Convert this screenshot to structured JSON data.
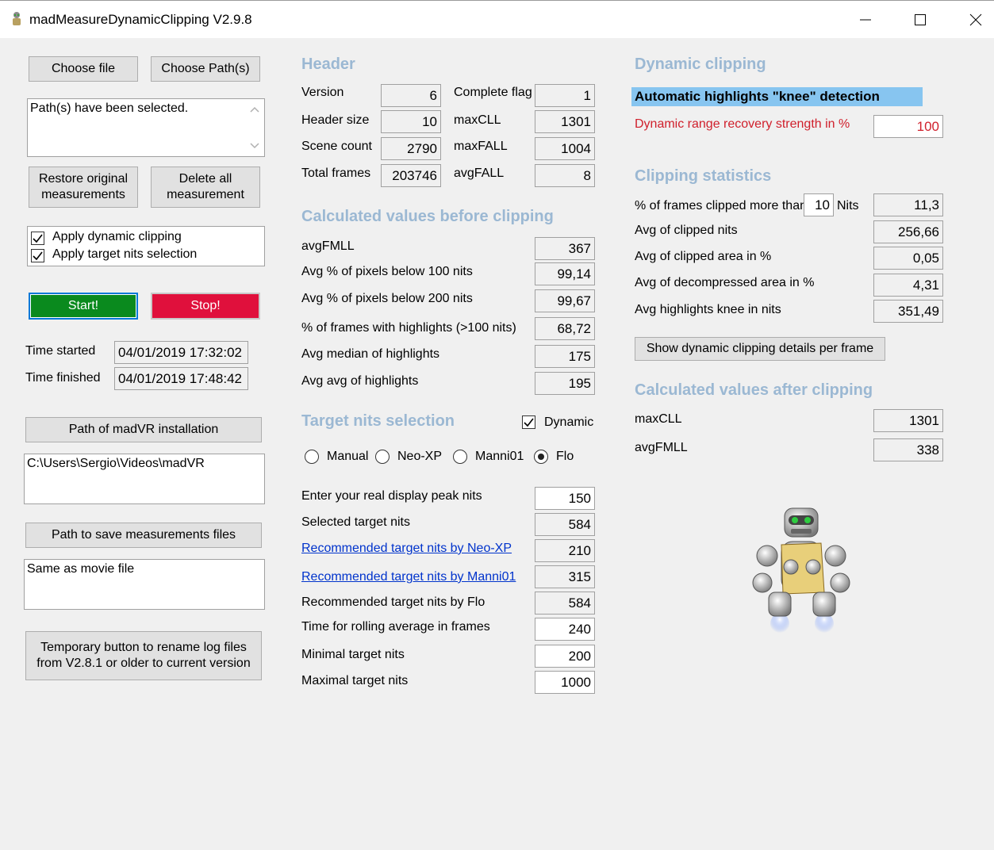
{
  "window": {
    "title": "madMeasureDynamicClipping V2.9.8"
  },
  "left": {
    "choose_file": "Choose file",
    "choose_paths": "Choose Path(s)",
    "status_text": "Path(s) have been selected.",
    "restore_line1": "Restore original",
    "restore_line2": "measurements",
    "delete_line1": "Delete all",
    "delete_line2": "measurement",
    "apply_dynamic_clipping": "Apply dynamic clipping",
    "apply_target_nits": "Apply target nits selection",
    "start": "Start!",
    "stop": "Stop!",
    "time_started_label": "Time started",
    "time_started": "04/01/2019 17:32:02",
    "time_finished_label": "Time finished",
    "time_finished": "04/01/2019 17:48:42",
    "madvr_path_button": "Path of madVR installation",
    "madvr_path": "C:\\Users\\Sergio\\Videos\\madVR",
    "save_path_button": "Path to save measurements files",
    "save_path": "Same as movie file",
    "rename_line1": "Temporary button to rename log files",
    "rename_line2": "from V2.8.1 or older to current version"
  },
  "header": {
    "title": "Header",
    "version_label": "Version",
    "version": "6",
    "complete_flag_label": "Complete flag",
    "complete_flag": "1",
    "header_size_label": "Header size",
    "header_size": "10",
    "maxcll_label": "maxCLL",
    "maxcll": "1301",
    "scene_count_label": "Scene count",
    "scene_count": "2790",
    "maxfall_label": "maxFALL",
    "maxfall": "1004",
    "total_frames_label": "Total frames",
    "total_frames": "203746",
    "avgfall_label": "avgFALL",
    "avgfall": "8"
  },
  "before": {
    "title": "Calculated values before clipping",
    "rows": [
      {
        "label": "avgFMLL",
        "value": "367"
      },
      {
        "label": "Avg % of pixels below 100 nits",
        "value": "99,14"
      },
      {
        "label": "Avg % of pixels below 200 nits",
        "value": "99,67"
      },
      {
        "label": "% of frames with highlights (>100 nits)",
        "value": "68,72"
      },
      {
        "label": "Avg median of highlights",
        "value": "175"
      },
      {
        "label": "Avg avg of highlights",
        "value": "195"
      }
    ]
  },
  "target": {
    "title": "Target nits selection",
    "dynamic_label": "Dynamic",
    "radio_manual": "Manual",
    "radio_neoxp": "Neo-XP",
    "radio_manni": "Manni01",
    "radio_flo": "Flo",
    "rows": [
      {
        "label": "Enter your real display peak nits",
        "value": "150"
      },
      {
        "label": "Selected target nits",
        "value": "584"
      },
      {
        "label": "Recommended target nits by Neo-XP",
        "value": "210"
      },
      {
        "label": "Recommended target nits by Manni01",
        "value": "315"
      },
      {
        "label": "Recommended target nits by Flo",
        "value": "584"
      },
      {
        "label": "Time for rolling average in frames",
        "value": "240"
      },
      {
        "label": "Minimal target nits",
        "value": "200"
      },
      {
        "label": "Maximal target nits",
        "value": "1000"
      }
    ]
  },
  "dynamic": {
    "title": "Dynamic clipping",
    "knee_heading": "Automatic highlights \"knee\" detection",
    "recovery_label": "Dynamic range recovery strength in %",
    "recovery_value": "100"
  },
  "stats": {
    "title": "Clipping statistics",
    "frames_clipped_prefix": "% of frames clipped more than",
    "frames_clipped_nits": "10",
    "frames_clipped_suffix": "Nits",
    "frames_clipped_value": "11,3",
    "rows": [
      {
        "label": "Avg of clipped nits",
        "value": "256,66"
      },
      {
        "label": "Avg of clipped area in %",
        "value": "0,05"
      },
      {
        "label": "Avg of decompressed area in %",
        "value": "4,31"
      },
      {
        "label": "Avg highlights knee in nits",
        "value": "351,49"
      }
    ],
    "details_button": "Show dynamic clipping details per frame"
  },
  "after": {
    "title": "Calculated values after clipping",
    "maxcll_label": "maxCLL",
    "maxcll": "1301",
    "avgfmll_label": "avgFMLL",
    "avgfmll": "338"
  },
  "colors": {
    "section_title": "#9bb8d3",
    "start_green": "#0a8a1e",
    "stop_red": "#e0103c",
    "knee_highlight": "#87c5f0"
  }
}
